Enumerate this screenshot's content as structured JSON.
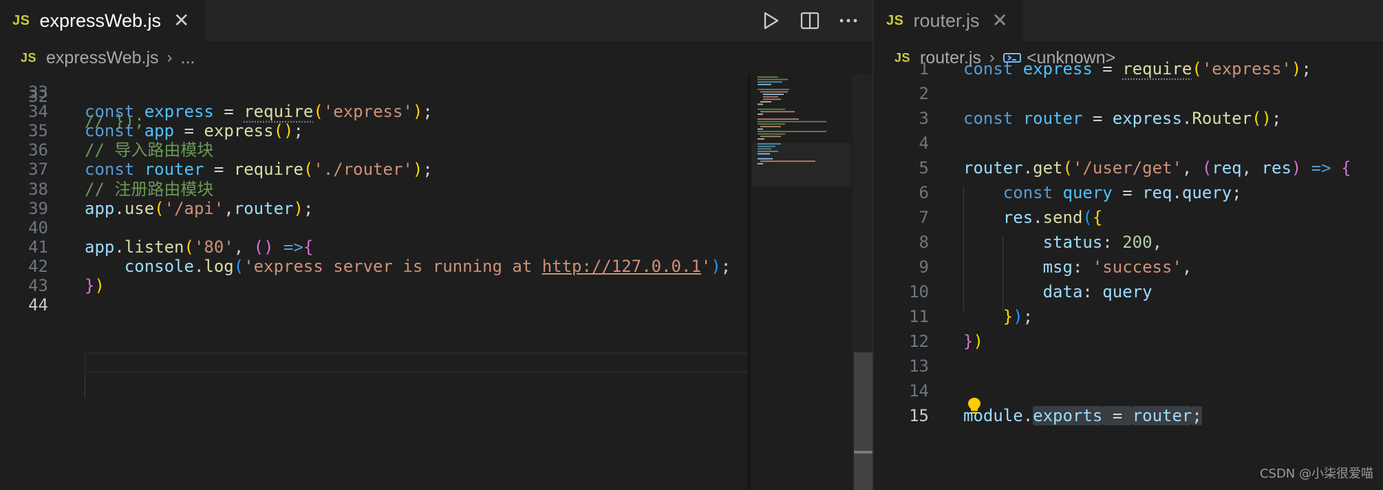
{
  "left_editor": {
    "tab": {
      "badge": "JS",
      "filename": "expressWeb.js",
      "close_glyph": "✕"
    },
    "breadcrumb": {
      "badge": "JS",
      "file": "expressWeb.js",
      "separator": "›",
      "rest": "..."
    },
    "actions": [
      {
        "name": "run-icon",
        "label": "Run"
      },
      {
        "name": "split-editor-icon",
        "label": "Split Editor"
      },
      {
        "name": "more-actions-icon",
        "label": "More Actions"
      }
    ],
    "current_line": 44,
    "lines": [
      {
        "num": "33",
        "tokens": []
      },
      {
        "num": "34",
        "tokens": [
          [
            "kw",
            "const "
          ],
          [
            "cst",
            "express"
          ],
          [
            "pun",
            " = "
          ],
          [
            "fn dots",
            "require"
          ],
          [
            "b1",
            "("
          ],
          [
            "str",
            "'express'"
          ],
          [
            "b1",
            ")"
          ],
          [
            "pun",
            ";"
          ]
        ]
      },
      {
        "num": "35",
        "tokens": [
          [
            "kw",
            "const "
          ],
          [
            "cst",
            "app"
          ],
          [
            "pun",
            " = "
          ],
          [
            "fn",
            "express"
          ],
          [
            "b1",
            "()"
          ],
          [
            "pun",
            ";"
          ]
        ]
      },
      {
        "num": "36",
        "tokens": [
          [
            "com",
            "// 导入路由模块"
          ]
        ]
      },
      {
        "num": "37",
        "tokens": [
          [
            "kw",
            "const "
          ],
          [
            "cst",
            "router"
          ],
          [
            "pun",
            " = "
          ],
          [
            "fn",
            "require"
          ],
          [
            "b1",
            "("
          ],
          [
            "str",
            "'./router'"
          ],
          [
            "b1",
            ")"
          ],
          [
            "pun",
            ";"
          ]
        ]
      },
      {
        "num": "38",
        "tokens": [
          [
            "com",
            "// 注册路由模块"
          ]
        ]
      },
      {
        "num": "39",
        "tokens": [
          [
            "var",
            "app"
          ],
          [
            "pun",
            "."
          ],
          [
            "fn",
            "use"
          ],
          [
            "b1",
            "("
          ],
          [
            "str",
            "'/api'"
          ],
          [
            "pun",
            ","
          ],
          [
            "var",
            "router"
          ],
          [
            "b1",
            ")"
          ],
          [
            "pun",
            ";"
          ]
        ]
      },
      {
        "num": "40",
        "tokens": []
      },
      {
        "num": "41",
        "tokens": [
          [
            "var",
            "app"
          ],
          [
            "pun",
            "."
          ],
          [
            "fn",
            "listen"
          ],
          [
            "b1",
            "("
          ],
          [
            "str",
            "'80'"
          ],
          [
            "pun",
            ", "
          ],
          [
            "b2",
            "()"
          ],
          [
            "kw",
            " =>"
          ],
          [
            "b2",
            "{"
          ]
        ]
      },
      {
        "num": "42",
        "tokens": [
          [
            "pun",
            "    "
          ],
          [
            "var",
            "console"
          ],
          [
            "pun",
            "."
          ],
          [
            "fn",
            "log"
          ],
          [
            "b3",
            "("
          ],
          [
            "str",
            "'express server is running at "
          ],
          [
            "str link",
            "http://127.0.0.1"
          ],
          [
            "str",
            "'"
          ],
          [
            "b3",
            ")"
          ],
          [
            "pun",
            ";"
          ]
        ]
      },
      {
        "num": "43",
        "tokens": [
          [
            "b2",
            "}"
          ],
          [
            "b1",
            ")"
          ]
        ]
      },
      {
        "num": "44",
        "tokens": []
      }
    ]
  },
  "right_editor": {
    "tab": {
      "badge": "JS",
      "filename": "router.js",
      "close_glyph": "✕"
    },
    "breadcrumb": {
      "badge": "JS",
      "file": "router.js",
      "separator": "›",
      "symbol": "<unknown>"
    },
    "current_line": 15,
    "lines": [
      {
        "num": "1",
        "tokens": [
          [
            "kw",
            "const "
          ],
          [
            "cst",
            "express"
          ],
          [
            "pun",
            " = "
          ],
          [
            "fn dots",
            "require"
          ],
          [
            "b1",
            "("
          ],
          [
            "str",
            "'express'"
          ],
          [
            "b1",
            ")"
          ],
          [
            "pun",
            ";"
          ]
        ]
      },
      {
        "num": "2",
        "tokens": []
      },
      {
        "num": "3",
        "tokens": [
          [
            "kw",
            "const "
          ],
          [
            "cst",
            "router"
          ],
          [
            "pun",
            " = "
          ],
          [
            "var",
            "express"
          ],
          [
            "pun",
            "."
          ],
          [
            "fn",
            "Router"
          ],
          [
            "b1",
            "()"
          ],
          [
            "pun",
            ";"
          ]
        ]
      },
      {
        "num": "4",
        "tokens": []
      },
      {
        "num": "5",
        "tokens": [
          [
            "var",
            "router"
          ],
          [
            "pun",
            "."
          ],
          [
            "fn",
            "get"
          ],
          [
            "b1",
            "("
          ],
          [
            "str",
            "'/user/get'"
          ],
          [
            "pun",
            ", "
          ],
          [
            "b2",
            "("
          ],
          [
            "var",
            "req"
          ],
          [
            "pun",
            ", "
          ],
          [
            "var",
            "res"
          ],
          [
            "b2",
            ")"
          ],
          [
            "kw",
            " => "
          ],
          [
            "b2",
            "{"
          ]
        ]
      },
      {
        "num": "6",
        "tokens": [
          [
            "pun",
            "    "
          ],
          [
            "kw",
            "const "
          ],
          [
            "cst",
            "query"
          ],
          [
            "pun",
            " = "
          ],
          [
            "var",
            "req"
          ],
          [
            "pun",
            "."
          ],
          [
            "var",
            "query"
          ],
          [
            "pun",
            ";"
          ]
        ]
      },
      {
        "num": "7",
        "tokens": [
          [
            "pun",
            "    "
          ],
          [
            "var",
            "res"
          ],
          [
            "pun",
            "."
          ],
          [
            "fn",
            "send"
          ],
          [
            "b3",
            "("
          ],
          [
            "b1",
            "{"
          ]
        ]
      },
      {
        "num": "8",
        "tokens": [
          [
            "pun",
            "        "
          ],
          [
            "var",
            "status"
          ],
          [
            "pun",
            ": "
          ],
          [
            "num",
            "200"
          ],
          [
            "pun",
            ","
          ]
        ]
      },
      {
        "num": "9",
        "tokens": [
          [
            "pun",
            "        "
          ],
          [
            "var",
            "msg"
          ],
          [
            "pun",
            ": "
          ],
          [
            "str",
            "'success'"
          ],
          [
            "pun",
            ","
          ]
        ]
      },
      {
        "num": "10",
        "tokens": [
          [
            "pun",
            "        "
          ],
          [
            "var",
            "data"
          ],
          [
            "pun",
            ": "
          ],
          [
            "var",
            "query"
          ]
        ]
      },
      {
        "num": "11",
        "tokens": [
          [
            "pun",
            "    "
          ],
          [
            "b1",
            "}"
          ],
          [
            "b3",
            ")"
          ],
          [
            "pun",
            ";"
          ]
        ]
      },
      {
        "num": "12",
        "tokens": [
          [
            "b2",
            "}"
          ],
          [
            "b1",
            ")"
          ]
        ]
      },
      {
        "num": "13",
        "tokens": []
      },
      {
        "num": "14",
        "tokens": []
      },
      {
        "num": "15",
        "tokens": [
          [
            "var",
            "module"
          ],
          [
            "pun",
            "."
          ],
          [
            "var word-hl",
            "exports"
          ],
          [
            "pun word-hl",
            " = "
          ],
          [
            "var word-hl",
            "router"
          ],
          [
            "pun word-hl",
            ";"
          ]
        ]
      }
    ]
  },
  "watermark": "CSDN @小柒很爱喵",
  "colors": {
    "js_badge": "#cbcb41",
    "editor_bg": "#1e1e1e",
    "tabbar_bg": "#252526",
    "keyword": "#569cd6",
    "string": "#ce9178",
    "comment": "#6a9955",
    "lightbulb": "#ffcc00"
  }
}
